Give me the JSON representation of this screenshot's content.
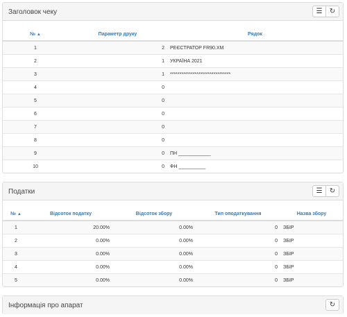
{
  "header_panel": {
    "title": "Заголовок чеку",
    "columns": [
      "№",
      "Параметр друку",
      "Рядок"
    ],
    "rows": [
      {
        "n": "1",
        "param": "2",
        "text": "РЕЄСТРАТОР FR90.XM"
      },
      {
        "n": "2",
        "param": "1",
        "text": "УКРАЇНА 2021"
      },
      {
        "n": "3",
        "param": "1",
        "text": "********************************"
      },
      {
        "n": "4",
        "param": "0",
        "text": ""
      },
      {
        "n": "5",
        "param": "0",
        "text": ""
      },
      {
        "n": "6",
        "param": "0",
        "text": ""
      },
      {
        "n": "7",
        "param": "0",
        "text": ""
      },
      {
        "n": "8",
        "param": "0",
        "text": ""
      },
      {
        "n": "9",
        "param": "0",
        "text": "ПН ____________"
      },
      {
        "n": "10",
        "param": "0",
        "text": "ФН __________"
      }
    ]
  },
  "tax_panel": {
    "title": "Податки",
    "columns": [
      "№",
      "Відсоток податку",
      "Відсоток збору",
      "Тип оподаткування",
      "Назва збору"
    ],
    "rows": [
      {
        "n": "1",
        "tax": "20.00%",
        "fee": "0.00%",
        "type": "0",
        "name": "ЗБІР"
      },
      {
        "n": "2",
        "tax": "0.00%",
        "fee": "0.00%",
        "type": "0",
        "name": "ЗБІР"
      },
      {
        "n": "3",
        "tax": "0.00%",
        "fee": "0.00%",
        "type": "0",
        "name": "ЗБІР"
      },
      {
        "n": "4",
        "tax": "0.00%",
        "fee": "0.00%",
        "type": "0",
        "name": "ЗБІР"
      },
      {
        "n": "5",
        "tax": "0.00%",
        "fee": "0.00%",
        "type": "0",
        "name": "ЗБІР"
      }
    ]
  },
  "device_panel": {
    "title": "Інформація про апарат"
  },
  "icons": {
    "list": "list-icon",
    "refresh": "refresh-icon",
    "sort": "sort-asc-icon"
  },
  "colors": {
    "header_link": "#337ab7",
    "panel_head_bg": "#f5f5f5",
    "stripe": "#f9f9f9"
  }
}
